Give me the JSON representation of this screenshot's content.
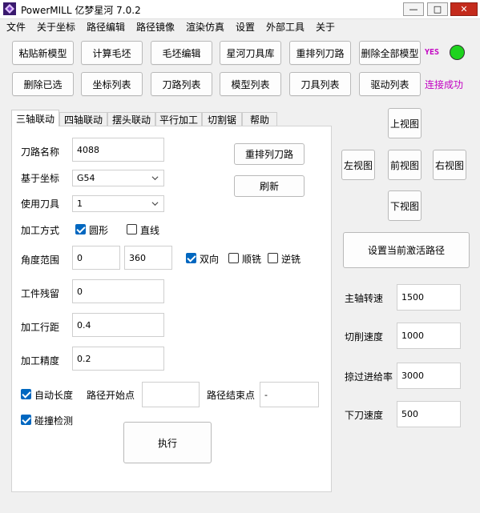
{
  "window": {
    "title": "PowerMILL 亿梦星河  7.0.2",
    "controls": {
      "minimize": "—",
      "maximize": "□",
      "close": "✕"
    }
  },
  "menu": [
    "文件",
    "关于坐标",
    "路径编辑",
    "路径镜像",
    "渲染仿真",
    "设置",
    "外部工具",
    "关于"
  ],
  "toolbar_row1": [
    "粘贴新模型",
    "计算毛坯",
    "毛坯编辑",
    "星河刀具库",
    "重排列刀路",
    "删除全部模型"
  ],
  "toolbar_row2": [
    "删除已选",
    "坐标列表",
    "刀路列表",
    "模型列表",
    "刀具列表",
    "驱动列表"
  ],
  "status": {
    "yes": "YES",
    "connection": "连接成功",
    "led_color": "#1ed31e"
  },
  "tabs": [
    "三轴联动",
    "四轴联动",
    "摆头联动",
    "平行加工",
    "切割锯",
    "帮助"
  ],
  "form": {
    "toolpath_name_label": "刀路名称",
    "toolpath_name": "4088",
    "coord_label": "基于坐标",
    "coord_value": "G54",
    "tool_label": "使用刀具",
    "tool_value": "1",
    "method_label": "加工方式",
    "method_circle": "圆形",
    "method_line": "直线",
    "angle_label": "角度范围",
    "angle_from": "0",
    "angle_to": "360",
    "bidir": "双向",
    "climb": "顺铣",
    "conventional": "逆铣",
    "stock_label": "工件残留",
    "stock_value": "0",
    "stepover_label": "加工行距",
    "stepover_value": "0.4",
    "tolerance_label": "加工精度",
    "tolerance_value": "0.2",
    "auto_length": "自动长度",
    "start_label": "路径开始点",
    "start_value": "",
    "end_label": "路径结束点",
    "end_value": "-",
    "collision": "碰撞检测",
    "execute": "执行",
    "reorder": "重排列刀路",
    "refresh": "刷新"
  },
  "views": {
    "top": "上视图",
    "left": "左视图",
    "front": "前视图",
    "right": "右视图",
    "bottom": "下视图"
  },
  "set_active": "设置当前激活路径",
  "speeds": {
    "spindle_label": "主轴转速",
    "spindle": "1500",
    "cut_label": "切削速度",
    "cut": "1000",
    "rapid_label": "掠过进给率",
    "rapid": "3000",
    "plunge_label": "下刀速度",
    "plunge": "500"
  }
}
